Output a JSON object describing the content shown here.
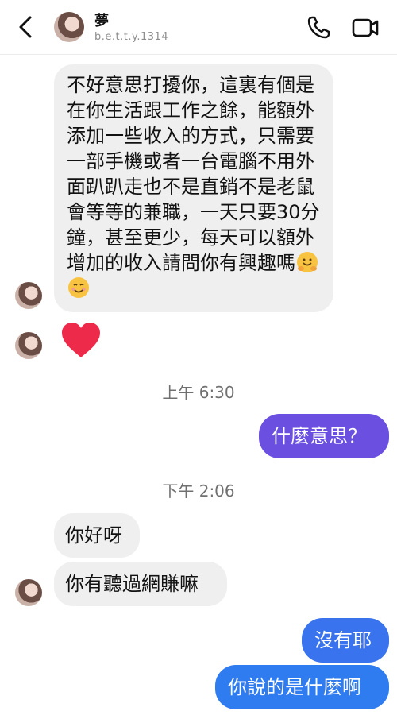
{
  "header": {
    "name": "夢",
    "username": "b.e.t.t.y.1314",
    "icons": [
      "back-arrow-icon",
      "phone-icon",
      "video-camera-icon"
    ]
  },
  "colors": {
    "incoming_bubble": "#efefef",
    "outgoing_purple": "#6a4fe0",
    "outgoing_blue": "#2f7cf0"
  },
  "messages": {
    "m1": "不好意思打擾你，這裏有個是在你生活跟工作之餘，能額外添加一些收入的方式，只需要一部手機或者一台電腦不用外面趴趴走也不是直銷不是老鼠會等等的兼職，一天只要30分鐘，甚至更少，每天可以額外增加的收入請問你有興趣嗎",
    "m1_emojis": [
      "hugging-face-emoji",
      "smiling-face-emoji"
    ],
    "time1": "上午 6:30",
    "m3": "什麼意思？",
    "time2": "下午 2:06",
    "m4": "你好呀",
    "m5": "你有聽過網賺嘛",
    "m6": "沒有耶",
    "m7": "你說的是什麼啊"
  }
}
